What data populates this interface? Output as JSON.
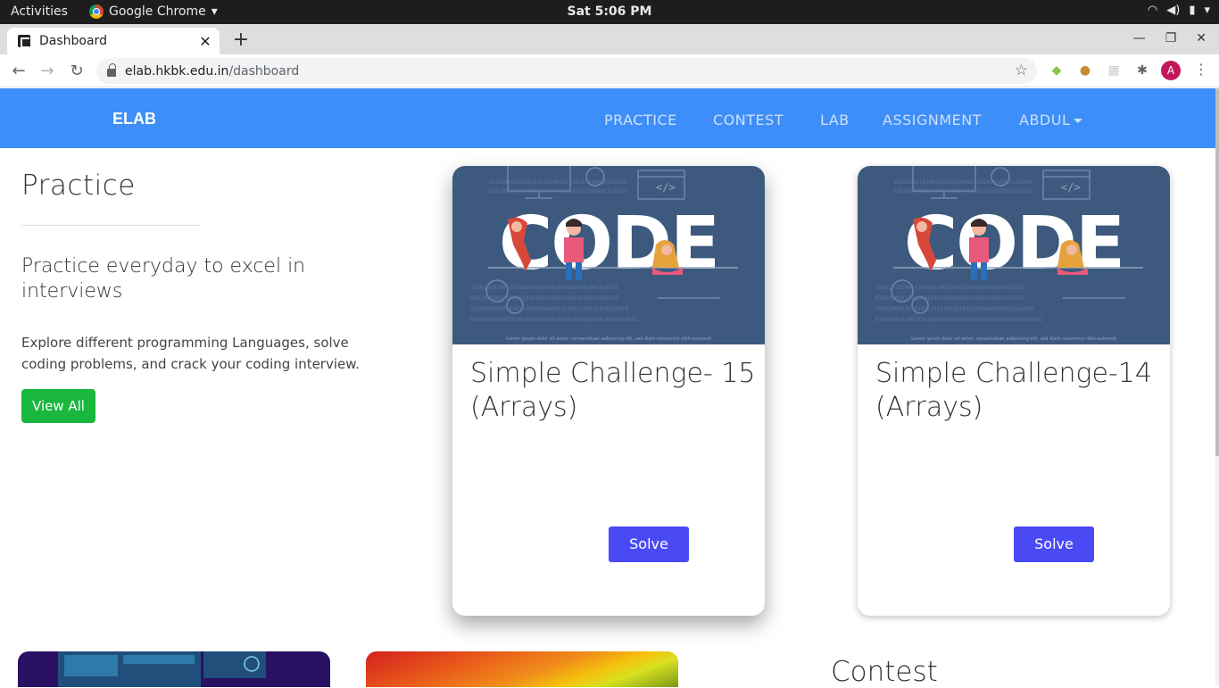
{
  "system_bar": {
    "activities": "Activities",
    "app_name": "Google Chrome",
    "clock": "Sat  5:06 PM"
  },
  "browser": {
    "tab_title": "Dashboard",
    "url_host": "elab.hkbk.edu.in",
    "url_path": "/dashboard",
    "profile_initial": "A"
  },
  "site": {
    "brand": "ELAB",
    "nav": [
      "PRACTICE",
      "CONTEST",
      "LAB",
      "ASSIGNMENT",
      "ABDUL"
    ]
  },
  "practice": {
    "heading": "Practice",
    "subheading": "Practice everyday to excel in interviews",
    "description": "Explore different programming Languages, solve coding problems, and crack your coding interview.",
    "view_all_label": "View All"
  },
  "cards": [
    {
      "image_text": "CODE",
      "title": "Simple Challenge- 15 (Arrays)",
      "button": "Solve"
    },
    {
      "image_text": "CODE",
      "title": "Simple Challenge-14 (Arrays)",
      "button": "Solve"
    }
  ],
  "contest": {
    "heading": "Contest"
  },
  "colors": {
    "navbar": "#3d8ef8",
    "view_all": "#19b73d",
    "solve_button": "#4a4af5",
    "card_image_bg": "#3d5a7e"
  }
}
